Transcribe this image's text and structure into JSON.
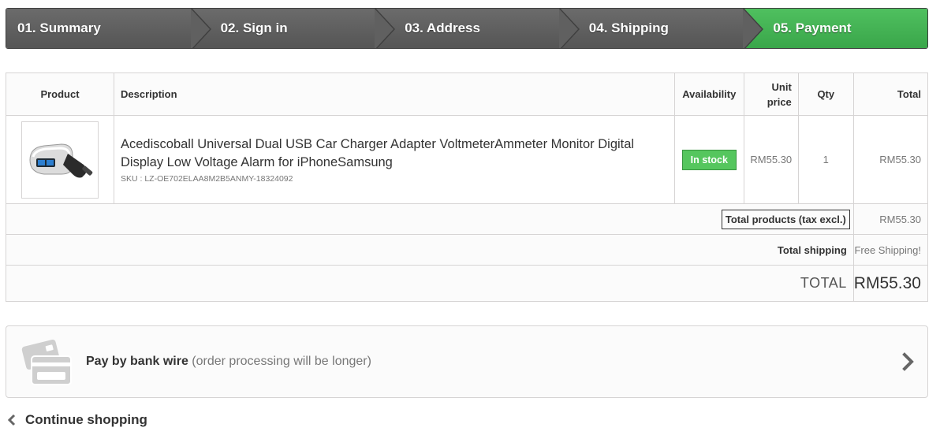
{
  "steps": [
    {
      "label": "01. Summary"
    },
    {
      "label": "02. Sign in"
    },
    {
      "label": "03. Address"
    },
    {
      "label": "04. Shipping"
    },
    {
      "label": "05. Payment",
      "active": true
    }
  ],
  "colors": {
    "active_step": "#45b653",
    "in_stock": "#55c65e"
  },
  "cart": {
    "headers": {
      "product": "Product",
      "description": "Description",
      "availability": "Availability",
      "unit_price": "Unit price",
      "qty": "Qty",
      "total": "Total"
    },
    "item": {
      "image_icon": "car-charger-product-image",
      "name": "Acediscoball Universal Dual USB Car Charger Adapter VoltmeterAmmeter Monitor Digital Display Low Voltage Alarm for iPhoneSamsung",
      "sku": "SKU : LZ-OE702ELAA8M2B5ANMY-18324092",
      "availability": "In stock",
      "unit_price": "RM55.30",
      "qty": "1",
      "total": "RM55.30"
    },
    "summary": {
      "total_products_label": "Total products (tax excl.)",
      "total_products_value": "RM55.30",
      "total_shipping_label": "Total shipping",
      "total_shipping_value": "Free Shipping!",
      "total_label": "TOTAL",
      "total_value": "RM55.30"
    }
  },
  "payment": {
    "icon": "credit-card-icon",
    "method": "Pay by bank wire",
    "note": "(order processing will be longer)"
  },
  "continue_shopping": {
    "icon": "chevron-left-icon",
    "label": "Continue shopping"
  }
}
